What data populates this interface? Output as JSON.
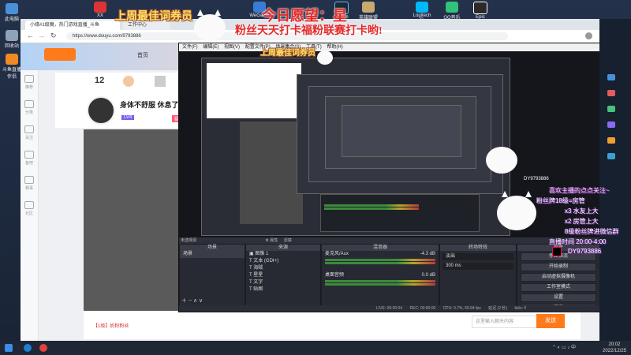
{
  "desktop": {
    "left_icons": [
      {
        "label": "此电脑"
      },
      {
        "label": "回收站"
      },
      {
        "label": "斗鱼直播伴侣"
      }
    ],
    "top_icons": [
      {
        "label": "XX"
      },
      {
        "label": "WeGame"
      },
      {
        "label": "Steam"
      },
      {
        "label": "英雄联盟"
      },
      {
        "label": "Logitech G"
      },
      {
        "label": "QQ音乐"
      },
      {
        "label": "Epic"
      }
    ]
  },
  "browser": {
    "tabs": [
      {
        "label": "小缘#1级魔，热门游戏直播_斗鱼"
      },
      {
        "label": "工作中心"
      }
    ],
    "url": "https://www.douyu.com/9793886",
    "nav_home": "首页",
    "sidebar": [
      {
        "label": "推荐"
      },
      {
        "label": "分类"
      },
      {
        "label": "关注"
      },
      {
        "label": "鱼吧"
      },
      {
        "label": "赛事"
      },
      {
        "label": "社区"
      }
    ],
    "anchor": {
      "level": "12",
      "status": "身体不舒服 休息了",
      "badge": "LV4",
      "tag": "福利领取"
    },
    "bottom": {
      "chat_placeholder": "这里输入聊天内容",
      "send_label": "发送",
      "gift_text": "【1级】奶粉粉丝"
    }
  },
  "obs": {
    "menu": [
      "文件(F)",
      "编辑(E)",
      "视图(V)",
      "配置文件(P)",
      "场景集合(S)",
      "工具(T)",
      "帮助(H)"
    ],
    "no_source": "未选择源",
    "tabs": [
      "属性",
      "滤镜"
    ],
    "docks": {
      "scenes": {
        "title": "场景",
        "items": [
          "场景"
        ]
      },
      "sources": {
        "title": "来源",
        "items": [
          "图像 1",
          "文本 (GDI+)",
          "海贼",
          "星星",
          "文字",
          "贴图"
        ]
      },
      "mixer": {
        "title": "混音器",
        "items": [
          {
            "name": "麦克风/Aux",
            "value": "-4.3 dB"
          },
          {
            "name": "桌面音频",
            "value": "0.0 dB"
          }
        ]
      },
      "transitions": {
        "title": "转场特效",
        "value": "淡出",
        "duration": "300 ms"
      },
      "controls": {
        "title": "控件",
        "buttons": [
          "停止推流",
          "开始录制",
          "启动虚拟摄像机",
          "工作室模式",
          "设置",
          "退出"
        ]
      }
    },
    "status": {
      "live": "LIVE: 00:00:04",
      "rec": "REC: 00:00:00",
      "cpu": "CPU: 0.7%, 59.94 fps",
      "delay": "延迟 (2 秒)",
      "kbps": "kb/s: 0"
    }
  },
  "overlays": {
    "weekly_title": "上周最佳词券员",
    "slogan_top": "今日愿望：星",
    "slogan_main": "粉丝天天打卡福粉联赛打卡哟!",
    "info": {
      "line1": "喜欢主播的点点关注~",
      "line2": "粉丝牌18级=房管",
      "line3": "x3 水友上大",
      "line4": "x2 房管上大",
      "line5": "8级粉丝牌进微信群",
      "line6": "直播时间 20:00-4:00",
      "line7": "DY9793886"
    },
    "nested_id": "DY9793886"
  },
  "taskbar": {
    "time": "20:02",
    "date": "2022/12/25"
  },
  "colors": {
    "slogan_red": "#e32828",
    "gold": "#ffe066",
    "obs_bg": "#2b2e38",
    "douyu_orange": "#ff7a1a",
    "info_purple": "#7d2fb0"
  }
}
